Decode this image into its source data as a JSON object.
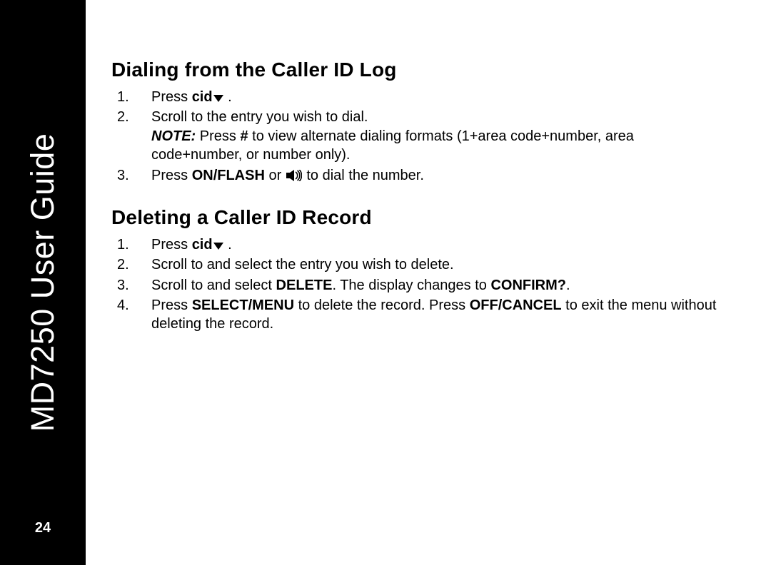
{
  "sidebar": {
    "title": "MD7250 User Guide",
    "page_number": "24"
  },
  "sections": [
    {
      "heading": "Dialing from the Caller ID Log",
      "steps": [
        {
          "prefix": "Press ",
          "bold1": "cid",
          "icon1": "arrow-down",
          "tail": " ."
        },
        {
          "line1": "Scroll to the entry you wish to dial.",
          "note_label": "NOTE:",
          "note_body_a": " Press ",
          "note_bold": "#",
          "note_body_b": " to view alternate dialing formats (1+area code+number, area code+number, or number only)."
        },
        {
          "prefix": "Press ",
          "bold1": "ON/FLASH",
          "mid": " or ",
          "icon1": "speaker",
          "tail": " to dial the number."
        }
      ]
    },
    {
      "heading": "Deleting a Caller ID Record",
      "steps": [
        {
          "prefix": "Press ",
          "bold1": "cid",
          "icon1": "arrow-down",
          "tail": " ."
        },
        {
          "line1": "Scroll to and select the entry you wish to delete."
        },
        {
          "prefix": "Scroll to and select ",
          "bold1": "DELETE",
          "mid": ". The display changes to ",
          "bold2": "CONFIRM?",
          "tail": "."
        },
        {
          "prefix": "Press ",
          "bold1": "SELECT/MENU",
          "mid": " to delete the record. Press ",
          "bold2": "OFF/CANCEL",
          "tail": " to exit the menu without deleting the record."
        }
      ]
    }
  ]
}
